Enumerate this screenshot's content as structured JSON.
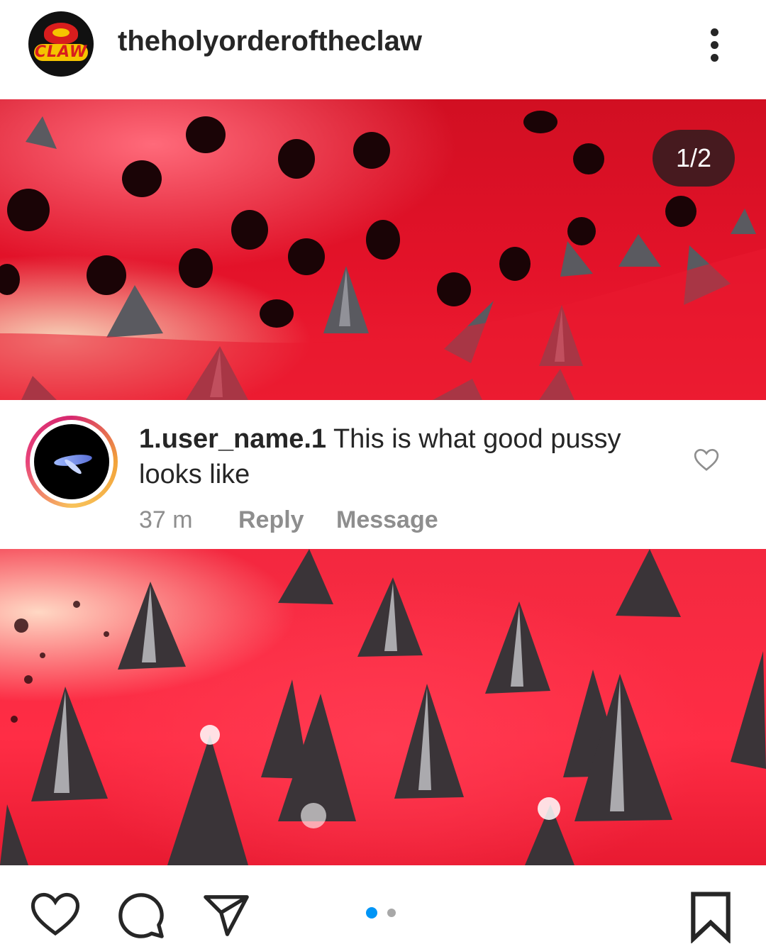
{
  "post": {
    "username": "theholyorderoftheclaw",
    "avatar_label": "CLAW",
    "image_counter": "1/2"
  },
  "comment": {
    "username": "1.user_name.1",
    "text": "This is what good pussy looks like",
    "time": "37 m",
    "reply_label": "Reply",
    "message_label": "Message"
  },
  "actions": {
    "like_icon": "heart-icon",
    "comment_icon": "comment-icon",
    "share_icon": "send-icon",
    "save_icon": "bookmark-icon",
    "pager_active": 1,
    "pager_total": 2
  },
  "colors": {
    "accent_blue": "#0095f6",
    "pager_inactive": "#a8a8a8",
    "text_primary": "#262626",
    "text_secondary": "#8e8e8e"
  }
}
